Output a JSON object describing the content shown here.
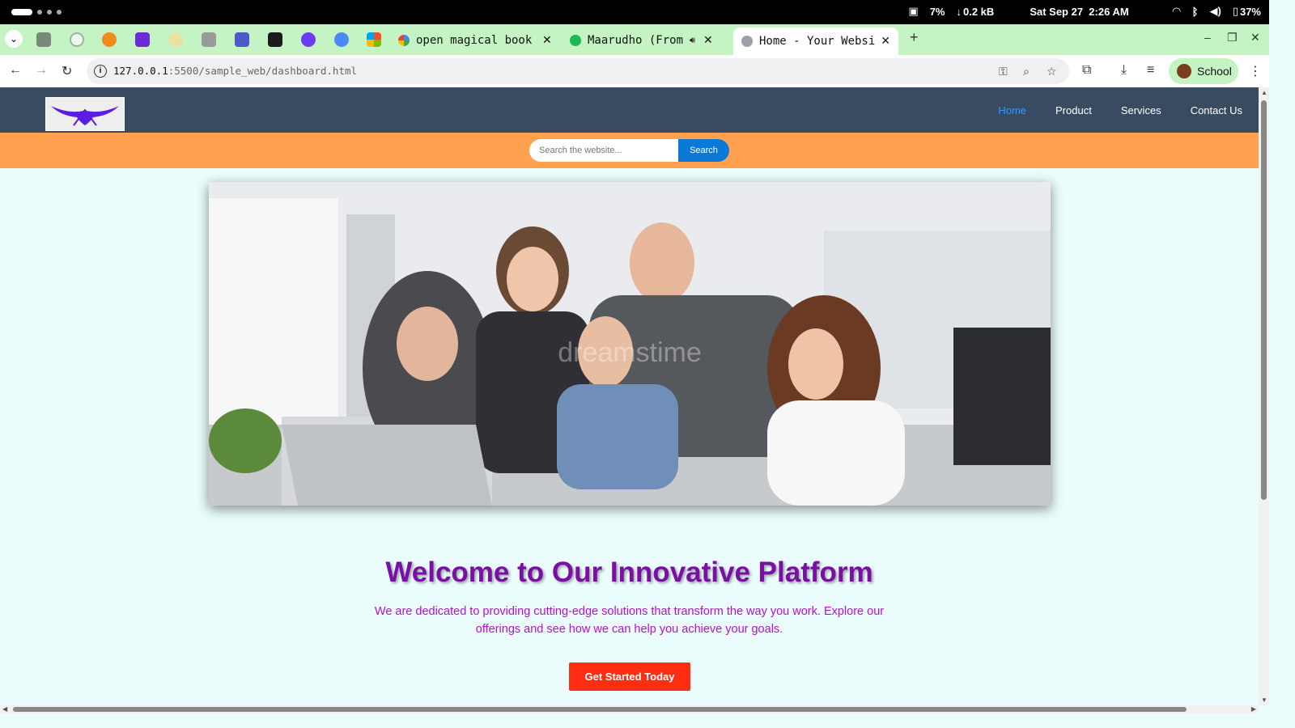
{
  "system_bar": {
    "cpu": "7%",
    "download": "0.2 kB",
    "datetime": "Sat Sep 27  2:26 AM",
    "battery": "37%"
  },
  "tabs": [
    {
      "title": "open magical book ",
      "favicon": "google-icon",
      "closable": true
    },
    {
      "title": "Maarudho (From \"",
      "favicon": "spotify-icon",
      "closable": true
    },
    {
      "title": "Home - Your Website",
      "favicon": "globe-icon",
      "closable": true,
      "active": true
    }
  ],
  "address_bar": {
    "host": "127.0.0.1",
    "path": ":5500/sample_web/dashboard.html"
  },
  "profile": {
    "label": "School"
  },
  "site": {
    "nav": [
      {
        "label": "Home",
        "active": true
      },
      {
        "label": "Product"
      },
      {
        "label": "Services"
      },
      {
        "label": "Contact Us"
      }
    ],
    "search": {
      "placeholder": "Search the website...",
      "button": "Search"
    },
    "hero_image_watermark": "dreamstime",
    "welcome_title": "Welcome to Our Innovative Platform",
    "welcome_text": "We are dedicated to providing cutting-edge solutions that transform the way you work. Explore our offerings and see how we can help you achieve your goals.",
    "cta": "Get Started Today"
  },
  "colors": {
    "nav_bg": "#394b61",
    "search_band": "#ffa14f",
    "page_bg": "#eafcfc",
    "title": "#7b0fa3",
    "text": "#b410d2",
    "cta": "#ff2d11",
    "link_active": "#3399ff"
  }
}
